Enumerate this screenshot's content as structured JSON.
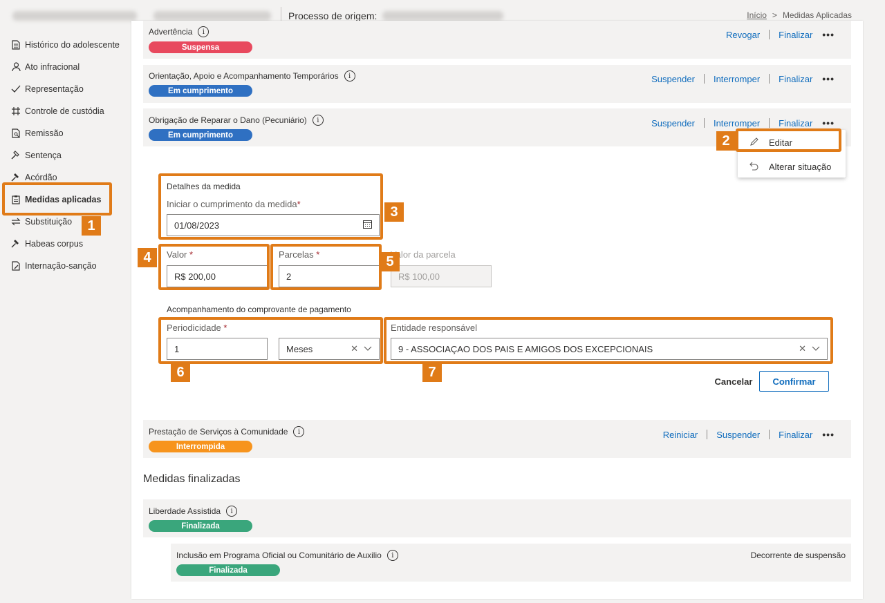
{
  "header": {
    "origin_label": "Processo de origem:",
    "breadcrumb_home": "Início",
    "breadcrumb_sep": ">",
    "breadcrumb_current": "Medidas Aplicadas"
  },
  "sidebar": {
    "items": [
      {
        "label": "Histórico do adolescente",
        "icon": "document-icon"
      },
      {
        "label": "Ato infracional",
        "icon": "person-icon"
      },
      {
        "label": "Representação",
        "icon": "checkmark-icon"
      },
      {
        "label": "Controle de custódia",
        "icon": "grid-icon"
      },
      {
        "label": "Remissão",
        "icon": "document-search-icon"
      },
      {
        "label": "Sentença",
        "icon": "gavel-icon"
      },
      {
        "label": "Acórdão",
        "icon": "gavel-icon"
      },
      {
        "label": "Medidas aplicadas",
        "icon": "clipboard-icon",
        "active": true
      },
      {
        "label": "Substituição",
        "icon": "swap-icon"
      },
      {
        "label": "Habeas corpus",
        "icon": "gavel-icon"
      },
      {
        "label": "Internação-sanção",
        "icon": "document-edit-icon"
      }
    ]
  },
  "measures": [
    {
      "title": "Advertência",
      "status": "Suspensa",
      "status_color": "#e8495e",
      "actions": [
        "Revogar",
        "Finalizar"
      ]
    },
    {
      "title": "Orientação, Apoio e Acompanhamento Temporários",
      "status": "Em cumprimento",
      "status_color": "#2f70c2",
      "actions": [
        "Suspender",
        "Interromper",
        "Finalizar"
      ]
    },
    {
      "title": "Obrigação de Reparar o Dano (Pecuniário)",
      "status": "Em cumprimento",
      "status_color": "#2f70c2",
      "actions": [
        "Suspender",
        "Interromper",
        "Finalizar"
      ]
    }
  ],
  "context_menu": {
    "edit": "Editar",
    "change_status": "Alterar situação"
  },
  "form": {
    "details_title": "Detalhes da medida",
    "start_label": "Iniciar o cumprimento da medida",
    "start_value": "01/08/2023",
    "value_label": "Valor",
    "value_value": "R$ 200,00",
    "installments_label": "Parcelas",
    "installments_value": "2",
    "installment_value_label": "Valor da parcela",
    "installment_value_value": "R$ 100,00",
    "receipt_title": "Acompanhamento do comprovante de pagamento",
    "periodicity_label": "Periodicidade",
    "periodicity_value": "1",
    "period_unit": "Meses",
    "entity_label": "Entidade responsável",
    "entity_value": "9 - ASSOCIAÇAO DOS PAIS E AMIGOS DOS EXCEPCIONAIS",
    "required_mark": "*",
    "cancel": "Cancelar",
    "confirm": "Confirmar"
  },
  "community_service": {
    "title": "Prestação de Serviços à Comunidade",
    "status": "Interrompida",
    "status_color": "#f7941d",
    "actions": [
      "Reiniciar",
      "Suspender",
      "Finalizar"
    ]
  },
  "finished": {
    "heading": "Medidas finalizadas",
    "items": [
      {
        "title": "Liberdade Assistida",
        "status": "Finalizada",
        "status_color": "#3aa67c"
      },
      {
        "title": "Inclusão em Programa Oficial ou Comunitário de Auxilio",
        "status": "Finalizada",
        "status_color": "#3aa67c",
        "note": "Decorrente de suspensão"
      }
    ]
  },
  "annotations": [
    "1",
    "2",
    "3",
    "4",
    "5",
    "6",
    "7"
  ],
  "colors": {
    "accent": "#0f6cbd",
    "annotation": "#e07b18"
  }
}
